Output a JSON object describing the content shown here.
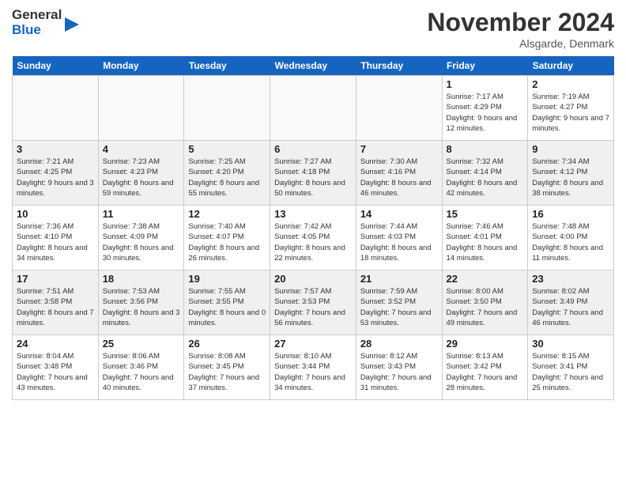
{
  "header": {
    "logo_general": "General",
    "logo_blue": "Blue",
    "month_title": "November 2024",
    "location": "Alsgarde, Denmark"
  },
  "weekdays": [
    "Sunday",
    "Monday",
    "Tuesday",
    "Wednesday",
    "Thursday",
    "Friday",
    "Saturday"
  ],
  "weeks": [
    [
      {
        "day": "",
        "sunrise": "",
        "sunset": "",
        "daylight": "",
        "empty": true
      },
      {
        "day": "",
        "sunrise": "",
        "sunset": "",
        "daylight": "",
        "empty": true
      },
      {
        "day": "",
        "sunrise": "",
        "sunset": "",
        "daylight": "",
        "empty": true
      },
      {
        "day": "",
        "sunrise": "",
        "sunset": "",
        "daylight": "",
        "empty": true
      },
      {
        "day": "",
        "sunrise": "",
        "sunset": "",
        "daylight": "",
        "empty": true
      },
      {
        "day": "1",
        "sunrise": "Sunrise: 7:17 AM",
        "sunset": "Sunset: 4:29 PM",
        "daylight": "Daylight: 9 hours and 12 minutes."
      },
      {
        "day": "2",
        "sunrise": "Sunrise: 7:19 AM",
        "sunset": "Sunset: 4:27 PM",
        "daylight": "Daylight: 9 hours and 7 minutes."
      }
    ],
    [
      {
        "day": "3",
        "sunrise": "Sunrise: 7:21 AM",
        "sunset": "Sunset: 4:25 PM",
        "daylight": "Daylight: 9 hours and 3 minutes."
      },
      {
        "day": "4",
        "sunrise": "Sunrise: 7:23 AM",
        "sunset": "Sunset: 4:23 PM",
        "daylight": "Daylight: 8 hours and 59 minutes."
      },
      {
        "day": "5",
        "sunrise": "Sunrise: 7:25 AM",
        "sunset": "Sunset: 4:20 PM",
        "daylight": "Daylight: 8 hours and 55 minutes."
      },
      {
        "day": "6",
        "sunrise": "Sunrise: 7:27 AM",
        "sunset": "Sunset: 4:18 PM",
        "daylight": "Daylight: 8 hours and 50 minutes."
      },
      {
        "day": "7",
        "sunrise": "Sunrise: 7:30 AM",
        "sunset": "Sunset: 4:16 PM",
        "daylight": "Daylight: 8 hours and 46 minutes."
      },
      {
        "day": "8",
        "sunrise": "Sunrise: 7:32 AM",
        "sunset": "Sunset: 4:14 PM",
        "daylight": "Daylight: 8 hours and 42 minutes."
      },
      {
        "day": "9",
        "sunrise": "Sunrise: 7:34 AM",
        "sunset": "Sunset: 4:12 PM",
        "daylight": "Daylight: 8 hours and 38 minutes."
      }
    ],
    [
      {
        "day": "10",
        "sunrise": "Sunrise: 7:36 AM",
        "sunset": "Sunset: 4:10 PM",
        "daylight": "Daylight: 8 hours and 34 minutes."
      },
      {
        "day": "11",
        "sunrise": "Sunrise: 7:38 AM",
        "sunset": "Sunset: 4:09 PM",
        "daylight": "Daylight: 8 hours and 30 minutes."
      },
      {
        "day": "12",
        "sunrise": "Sunrise: 7:40 AM",
        "sunset": "Sunset: 4:07 PM",
        "daylight": "Daylight: 8 hours and 26 minutes."
      },
      {
        "day": "13",
        "sunrise": "Sunrise: 7:42 AM",
        "sunset": "Sunset: 4:05 PM",
        "daylight": "Daylight: 8 hours and 22 minutes."
      },
      {
        "day": "14",
        "sunrise": "Sunrise: 7:44 AM",
        "sunset": "Sunset: 4:03 PM",
        "daylight": "Daylight: 8 hours and 18 minutes."
      },
      {
        "day": "15",
        "sunrise": "Sunrise: 7:46 AM",
        "sunset": "Sunset: 4:01 PM",
        "daylight": "Daylight: 8 hours and 14 minutes."
      },
      {
        "day": "16",
        "sunrise": "Sunrise: 7:48 AM",
        "sunset": "Sunset: 4:00 PM",
        "daylight": "Daylight: 8 hours and 11 minutes."
      }
    ],
    [
      {
        "day": "17",
        "sunrise": "Sunrise: 7:51 AM",
        "sunset": "Sunset: 3:58 PM",
        "daylight": "Daylight: 8 hours and 7 minutes."
      },
      {
        "day": "18",
        "sunrise": "Sunrise: 7:53 AM",
        "sunset": "Sunset: 3:56 PM",
        "daylight": "Daylight: 8 hours and 3 minutes."
      },
      {
        "day": "19",
        "sunrise": "Sunrise: 7:55 AM",
        "sunset": "Sunset: 3:55 PM",
        "daylight": "Daylight: 8 hours and 0 minutes."
      },
      {
        "day": "20",
        "sunrise": "Sunrise: 7:57 AM",
        "sunset": "Sunset: 3:53 PM",
        "daylight": "Daylight: 7 hours and 56 minutes."
      },
      {
        "day": "21",
        "sunrise": "Sunrise: 7:59 AM",
        "sunset": "Sunset: 3:52 PM",
        "daylight": "Daylight: 7 hours and 53 minutes."
      },
      {
        "day": "22",
        "sunrise": "Sunrise: 8:00 AM",
        "sunset": "Sunset: 3:50 PM",
        "daylight": "Daylight: 7 hours and 49 minutes."
      },
      {
        "day": "23",
        "sunrise": "Sunrise: 8:02 AM",
        "sunset": "Sunset: 3:49 PM",
        "daylight": "Daylight: 7 hours and 46 minutes."
      }
    ],
    [
      {
        "day": "24",
        "sunrise": "Sunrise: 8:04 AM",
        "sunset": "Sunset: 3:48 PM",
        "daylight": "Daylight: 7 hours and 43 minutes."
      },
      {
        "day": "25",
        "sunrise": "Sunrise: 8:06 AM",
        "sunset": "Sunset: 3:46 PM",
        "daylight": "Daylight: 7 hours and 40 minutes."
      },
      {
        "day": "26",
        "sunrise": "Sunrise: 8:08 AM",
        "sunset": "Sunset: 3:45 PM",
        "daylight": "Daylight: 7 hours and 37 minutes."
      },
      {
        "day": "27",
        "sunrise": "Sunrise: 8:10 AM",
        "sunset": "Sunset: 3:44 PM",
        "daylight": "Daylight: 7 hours and 34 minutes."
      },
      {
        "day": "28",
        "sunrise": "Sunrise: 8:12 AM",
        "sunset": "Sunset: 3:43 PM",
        "daylight": "Daylight: 7 hours and 31 minutes."
      },
      {
        "day": "29",
        "sunrise": "Sunrise: 8:13 AM",
        "sunset": "Sunset: 3:42 PM",
        "daylight": "Daylight: 7 hours and 28 minutes."
      },
      {
        "day": "30",
        "sunrise": "Sunrise: 8:15 AM",
        "sunset": "Sunset: 3:41 PM",
        "daylight": "Daylight: 7 hours and 25 minutes."
      }
    ]
  ]
}
